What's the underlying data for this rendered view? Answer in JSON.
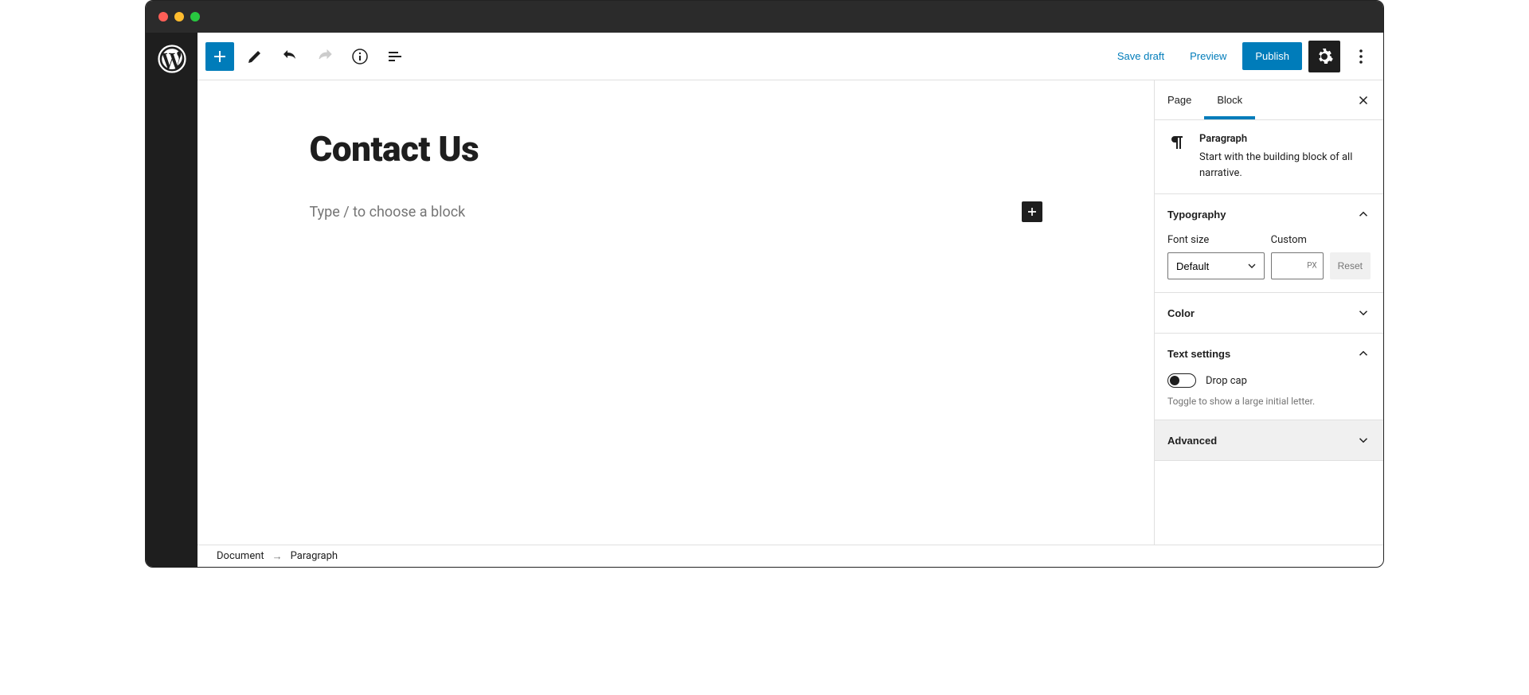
{
  "toolbar": {
    "save_draft": "Save draft",
    "preview": "Preview",
    "publish": "Publish"
  },
  "editor": {
    "page_title": "Contact Us",
    "block_placeholder": "Type / to choose a block"
  },
  "sidebar": {
    "tabs": {
      "page": "Page",
      "block": "Block"
    },
    "block_info": {
      "title": "Paragraph",
      "description": "Start with the building block of all narrative."
    },
    "typography": {
      "title": "Typography",
      "font_size_label": "Font size",
      "font_size_value": "Default",
      "custom_label": "Custom",
      "custom_unit": "PX",
      "reset_label": "Reset"
    },
    "color": {
      "title": "Color"
    },
    "text_settings": {
      "title": "Text settings",
      "drop_cap_label": "Drop cap",
      "drop_cap_help": "Toggle to show a large initial letter."
    },
    "advanced": {
      "title": "Advanced"
    }
  },
  "breadcrumbs": {
    "root": "Document",
    "current": "Paragraph"
  }
}
